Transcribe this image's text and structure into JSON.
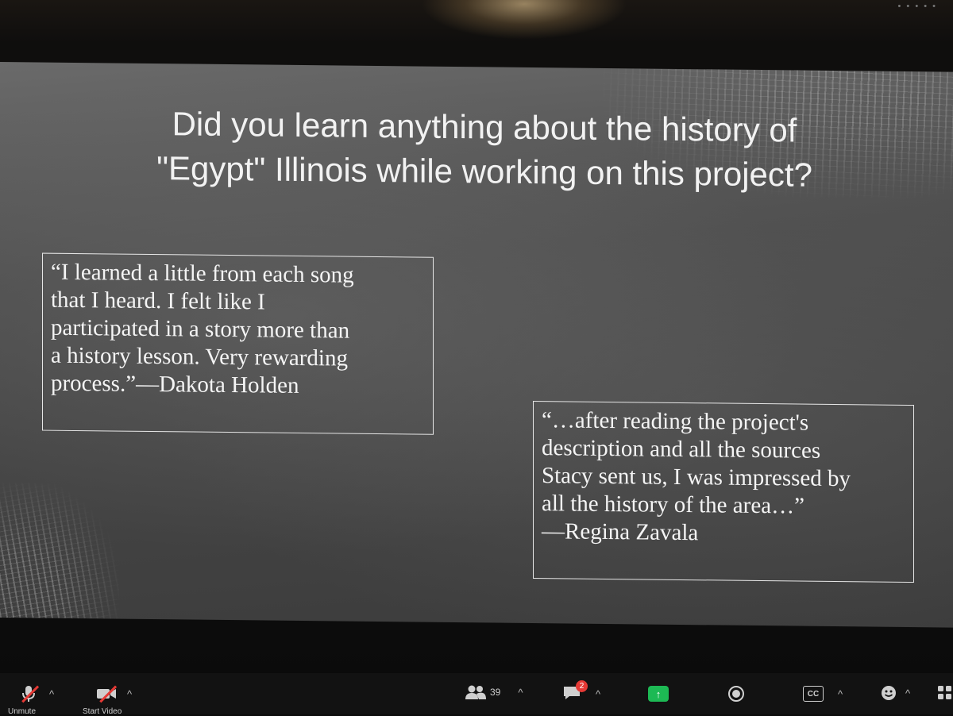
{
  "window": {
    "top_dots": "• • • • •"
  },
  "slide": {
    "title_line1": "Did you learn anything about the history of",
    "title_line2": "\"Egypt\" Illinois while working on this project?",
    "quotes": [
      {
        "text": "“I learned a little from each song\nthat I heard. I felt like I\nparticipated in a story more than\na history lesson. Very rewarding\nprocess.”—Dakota Holden"
      },
      {
        "text": "“…after reading the project's\ndescription and all the sources\nStacy sent us, I was impressed by\nall the history of the area…”\n—Regina Zavala"
      }
    ]
  },
  "toolbar": {
    "unmute_label": "Unmute",
    "video_label": "Start Video",
    "participants_count": "39",
    "chat_badge": "2",
    "share_arrow": "↑",
    "cc_label": "CC",
    "caret": "^",
    "icons": {
      "mic": "microphone-muted-icon",
      "video": "video-off-icon",
      "participants": "participants-icon",
      "chat": "chat-icon",
      "share": "share-screen-icon",
      "record": "record-icon",
      "captions": "closed-captions-icon",
      "reactions": "reactions-icon",
      "apps": "apps-icon"
    },
    "colors": {
      "mute_slash": "#e53935",
      "share": "#1db954",
      "badge": "#e53935"
    }
  }
}
